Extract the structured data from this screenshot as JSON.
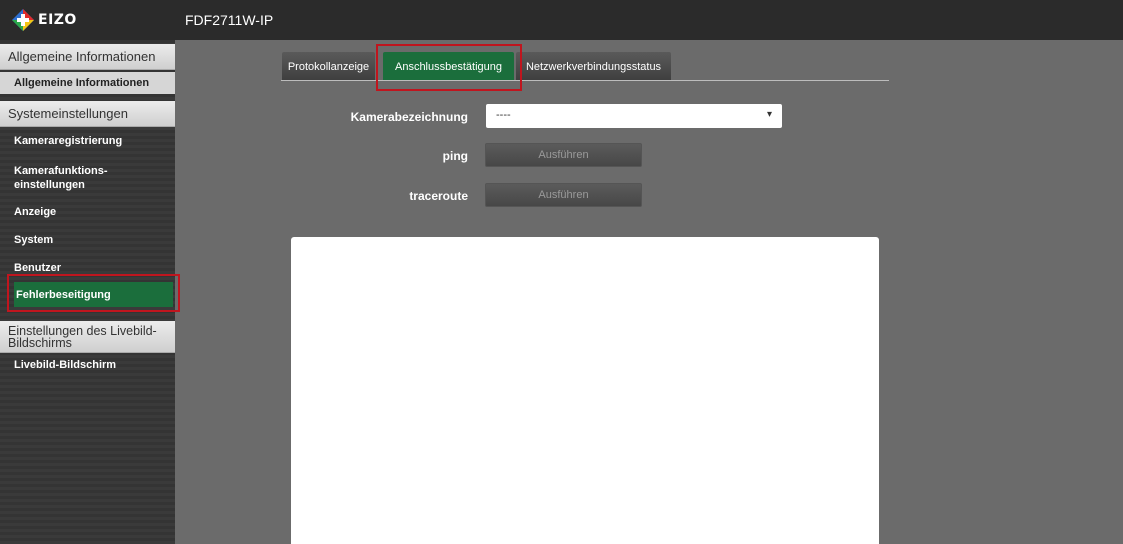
{
  "header": {
    "logo_text": "EIZO",
    "model": "FDF2711W-IP"
  },
  "sidebar": {
    "sections": [
      {
        "label": "Allgemeine Informationen"
      },
      {
        "label": "Systemeinstellungen"
      },
      {
        "label": "Einstellungen des Livebild-Bildschirms"
      }
    ],
    "items": [
      {
        "label": "Allgemeine Informationen"
      },
      {
        "label": "Kameraregistrierung"
      },
      {
        "label": "Kamerafunktions-einstellungen"
      },
      {
        "label": "Anzeige"
      },
      {
        "label": "System"
      },
      {
        "label": "Benutzer"
      },
      {
        "label": "Fehlerbeseitigung"
      },
      {
        "label": "Livebild-Bildschirm"
      }
    ]
  },
  "tabs": [
    {
      "label": "Protokollanzeige"
    },
    {
      "label": "Anschlussbestätigung"
    },
    {
      "label": "Netzwerkverbindungsstatus"
    }
  ],
  "form": {
    "camera_label": "Kamerabezeichnung",
    "camera_value": "----",
    "ping_label": "ping",
    "ping_button": "Ausführen",
    "traceroute_label": "traceroute",
    "traceroute_button": "Ausführen"
  },
  "colors": {
    "accent": "#1b6e3c",
    "highlight": "#c0151e"
  }
}
